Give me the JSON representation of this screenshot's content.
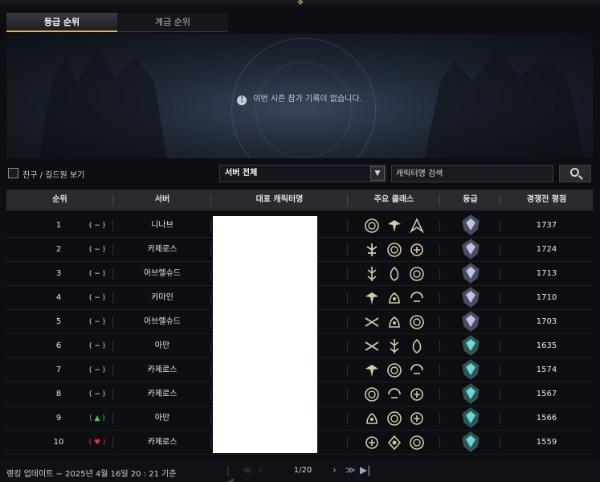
{
  "tabs": [
    {
      "label": "등급 순위",
      "active": true
    },
    {
      "label": "계급 순위",
      "active": false
    }
  ],
  "notice": {
    "text": "이번 시즌 참가 기록이 없습니다.",
    "icon": "info-icon"
  },
  "filters": {
    "friends_checkbox_label": "친구 / 길드원 보기",
    "friends_checked": false,
    "server_selected": "서버 전체",
    "search_placeholder": "캐릭터명 검색"
  },
  "table": {
    "headers": [
      "순위",
      "서버",
      "대표 캐릭터명",
      "주요 클래스",
      "등급",
      "경쟁전 평점"
    ],
    "rows": [
      {
        "rank": "1",
        "change": "( − )",
        "change_type": "none",
        "server": "니나브",
        "classes": [
          "class-icon-a",
          "class-icon-b",
          "class-icon-c"
        ],
        "grade": "silver",
        "rating": "1737"
      },
      {
        "rank": "2",
        "change": "( − )",
        "change_type": "none",
        "server": "카제로스",
        "classes": [
          "class-icon-d",
          "class-icon-a",
          "class-icon-e"
        ],
        "grade": "silver",
        "rating": "1724"
      },
      {
        "rank": "3",
        "change": "( − )",
        "change_type": "none",
        "server": "아브렐슈드",
        "classes": [
          "class-icon-f",
          "class-icon-g",
          "class-icon-a"
        ],
        "grade": "silver",
        "rating": "1713"
      },
      {
        "rank": "4",
        "change": "( − )",
        "change_type": "none",
        "server": "카마인",
        "classes": [
          "class-icon-b",
          "class-icon-h",
          "class-icon-i"
        ],
        "grade": "silver",
        "rating": "1710"
      },
      {
        "rank": "5",
        "change": "( − )",
        "change_type": "none",
        "server": "아브렐슈드",
        "classes": [
          "class-icon-j",
          "class-icon-h",
          "class-icon-a"
        ],
        "grade": "silver",
        "rating": "1703"
      },
      {
        "rank": "6",
        "change": "( − )",
        "change_type": "none",
        "server": "아만",
        "classes": [
          "class-icon-j",
          "class-icon-f",
          "class-icon-g"
        ],
        "grade": "diamond",
        "rating": "1635"
      },
      {
        "rank": "7",
        "change": "( − )",
        "change_type": "none",
        "server": "카제로스",
        "classes": [
          "class-icon-b",
          "class-icon-a",
          "class-icon-i"
        ],
        "grade": "diamond",
        "rating": "1574"
      },
      {
        "rank": "8",
        "change": "( − )",
        "change_type": "none",
        "server": "카제로스",
        "classes": [
          "class-icon-a",
          "class-icon-i",
          "class-icon-e"
        ],
        "grade": "diamond",
        "rating": "1567"
      },
      {
        "rank": "9",
        "change": "( ▲ )",
        "change_type": "up",
        "server": "아만",
        "classes": [
          "class-icon-h",
          "class-icon-a",
          "class-icon-e"
        ],
        "grade": "diamond",
        "rating": "1566"
      },
      {
        "rank": "10",
        "change": "( ♥ )",
        "change_type": "down",
        "server": "카제로스",
        "classes": [
          "class-icon-e",
          "class-icon-k",
          "class-icon-a"
        ],
        "grade": "diamond",
        "rating": "1559"
      }
    ]
  },
  "footer": {
    "update_text": "랭킹 업데이트 − 2025년 4월 16일 20 : 21 기준",
    "page_indicator": "1/20"
  },
  "colors": {
    "accent_gold": "#d8b46c",
    "rank_up": "#3ed34f",
    "rank_down": "#e0333a",
    "grade_silver": "#b8c4e8",
    "grade_diamond": "#6fd6d4"
  }
}
